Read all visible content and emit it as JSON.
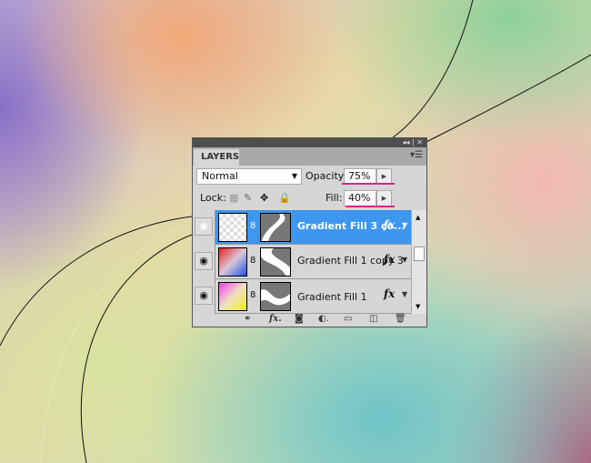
{
  "panel": {
    "title": "LAYERS",
    "collapse_icon": "double-chevron-left-icon",
    "close_icon": "close-icon"
  },
  "blend_mode": "Normal",
  "opacity": {
    "label": "Opacity:",
    "value": "75%"
  },
  "lock": {
    "label": "Lock:"
  },
  "fill": {
    "label": "Fill:",
    "value": "40%"
  },
  "layers": [
    {
      "name": "Gradient Fill 3 co...",
      "selected": true
    },
    {
      "name": "Gradient Fill 1 copy 3",
      "selected": false
    },
    {
      "name": "Gradient Fill 1",
      "selected": false
    }
  ],
  "fx_label": "fx",
  "colors": {
    "selection": "#3d96ef",
    "highlight": "#e0208a"
  }
}
